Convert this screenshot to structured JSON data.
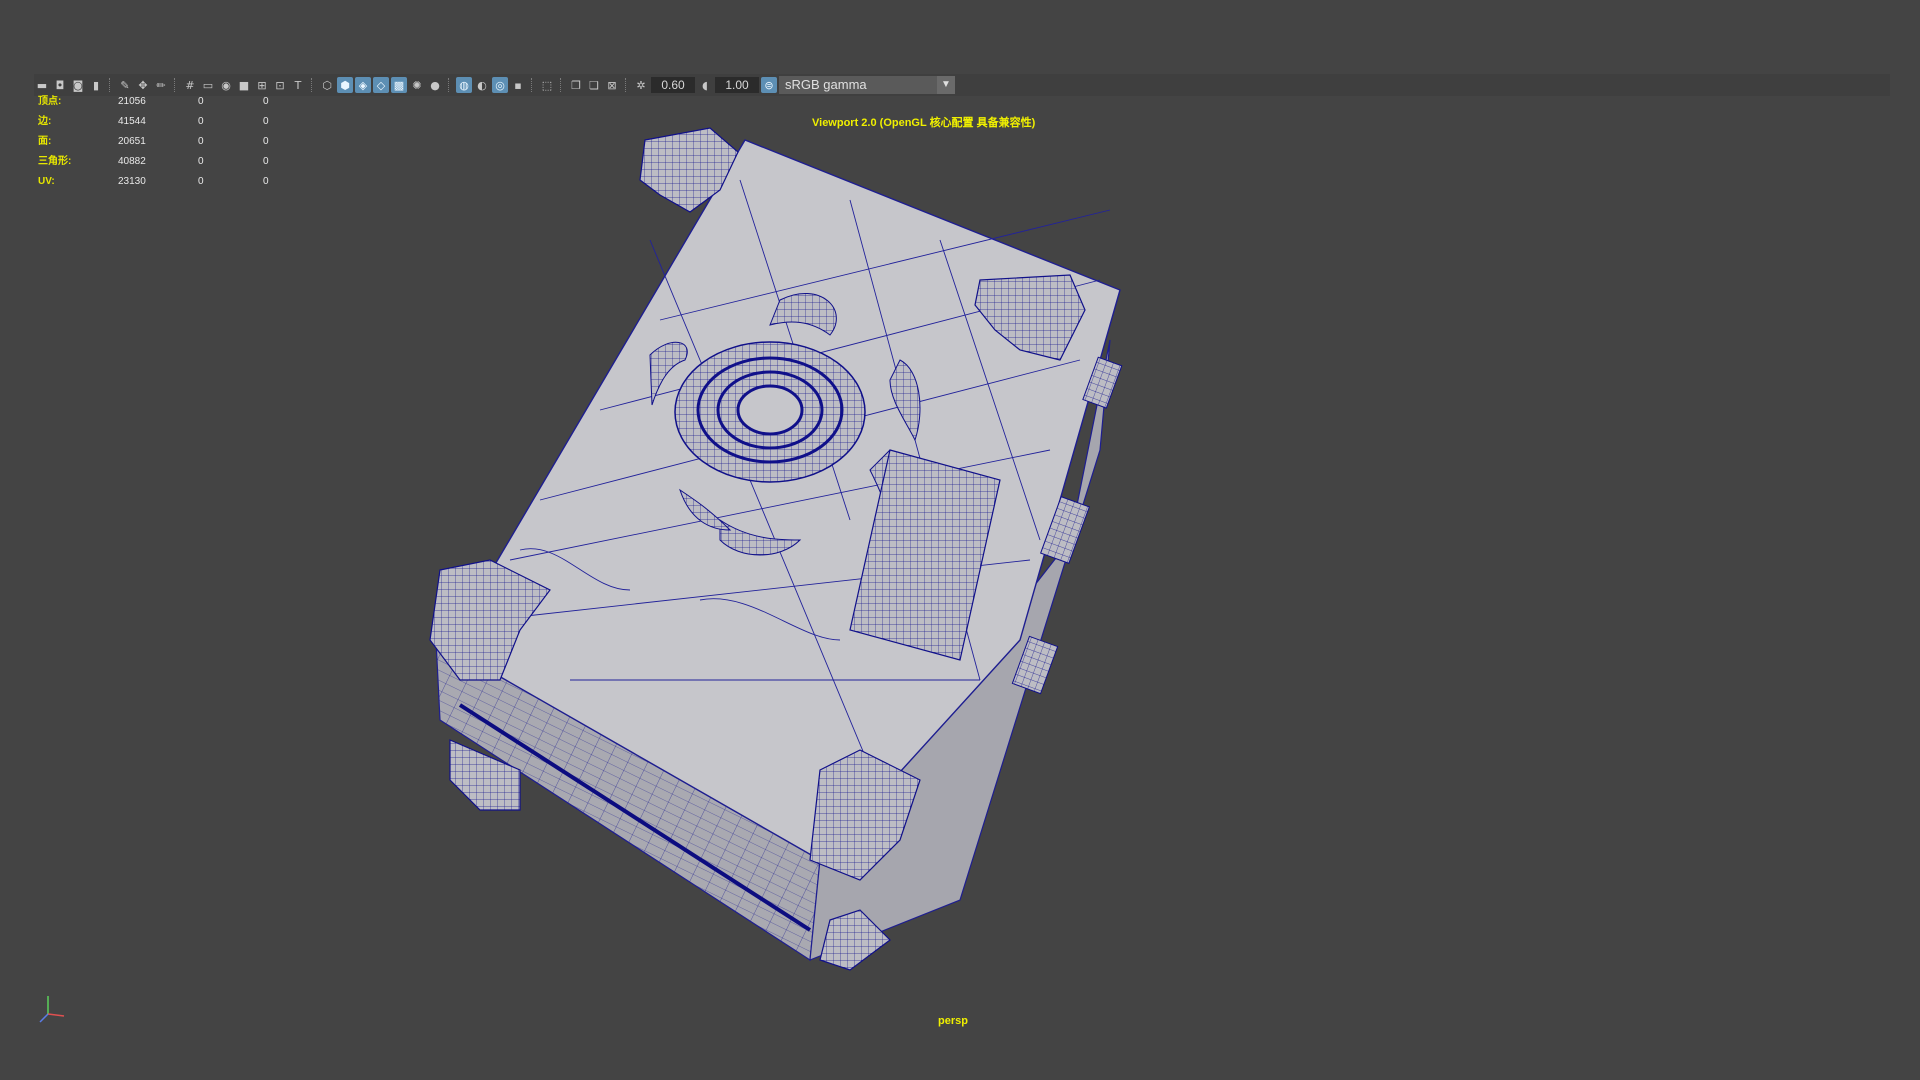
{
  "toolbar": {
    "icons": [
      "camera-icon",
      "camera-attr-icon",
      "camera-bookmark-icon",
      "bookmark-icon",
      "image-plane-icon",
      "pan-zoom-icon",
      "grease-pencil-icon",
      "grid-icon",
      "film-gate-icon",
      "resolution-gate-icon",
      "gate-mask-icon",
      "field-chart-icon",
      "safe-action-icon",
      "safe-title-icon",
      "wireframe-icon",
      "smooth-shade-icon",
      "wireframe-on-shaded-icon",
      "xray-icon",
      "xray-joints-icon",
      "lights-icon",
      "shadows-icon",
      "ambient-occlusion-icon",
      "motion-blur-icon",
      "anti-alias-icon",
      "depth-of-field-icon",
      "isolate-select-icon",
      "xray-active-icon",
      "select-camera-icon",
      "exposure-icon",
      "gamma-icon",
      "color-management-icon"
    ],
    "exposure_value": "0.60",
    "gamma_value": "1.00",
    "color_space": "sRGB gamma"
  },
  "hud": {
    "rows": [
      {
        "label": "顶点:",
        "value": "21056",
        "z1": "0",
        "z2": "0"
      },
      {
        "label": "边:",
        "value": "41544",
        "z1": "0",
        "z2": "0"
      },
      {
        "label": "面:",
        "value": "20651",
        "z1": "0",
        "z2": "0"
      },
      {
        "label": "三角形:",
        "value": "40882",
        "z1": "0",
        "z2": "0"
      },
      {
        "label": "UV:",
        "value": "23130",
        "z1": "0",
        "z2": "0"
      }
    ],
    "renderer": "Viewport 2.0 (OpenGL 核心配置 具备兼容性)",
    "camera": "persp"
  },
  "colors": {
    "background": "#444444",
    "hud_label": "#e6e600",
    "wire": "#1a1a8c",
    "mesh_face": "#c8c8cc"
  }
}
